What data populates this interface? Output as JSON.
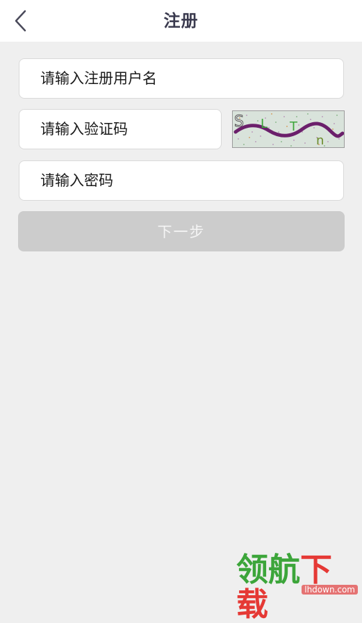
{
  "header": {
    "title": "注册",
    "back_icon": "chevron-left-icon"
  },
  "form": {
    "username_placeholder": "请输入注册用户名",
    "captcha_placeholder": "请输入验证码",
    "password_placeholder": "请输入密码",
    "captcha_text": "SLTn",
    "next_label": "下一步"
  },
  "watermark": {
    "part1": "领航",
    "part2": "下载",
    "url": "lhdown.com"
  },
  "colors": {
    "background": "#efefef",
    "header_bg": "#ffffff",
    "title": "#3a3a4e",
    "button_disabled": "#cccccc",
    "captcha_bg": "#d9e3db",
    "watermark_green": "#3ca53a",
    "watermark_red": "#e53935"
  }
}
